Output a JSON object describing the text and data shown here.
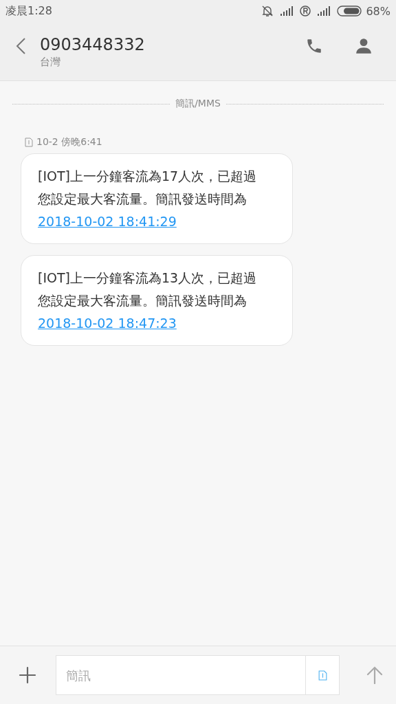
{
  "status_bar": {
    "time": "凌晨1:28",
    "battery": "68%"
  },
  "header": {
    "title": "0903448332",
    "subtitle": "台灣"
  },
  "divider_label": "簡訊/MMS",
  "timestamp": "10-2 傍晚6:41",
  "messages": [
    {
      "text": "[IOT]上一分鐘客流為17人次，已超過您設定最大客流量。簡訊發送時間為",
      "link": "2018-10-02 18:41:29"
    },
    {
      "text": "[IOT]上一分鐘客流為13人次，已超過您設定最大客流量。簡訊發送時間為",
      "link": "2018-10-02 18:47:23"
    }
  ],
  "composer": {
    "placeholder": "簡訊"
  }
}
